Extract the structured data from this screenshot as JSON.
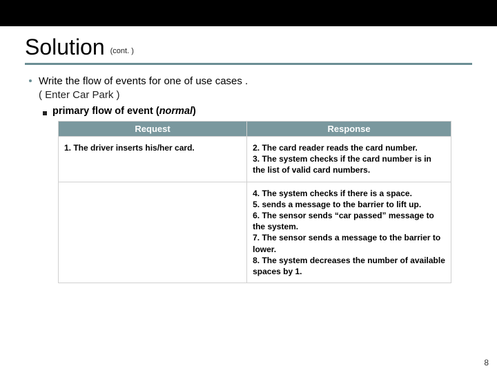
{
  "title": "Solution",
  "title_suffix": "(cont. )",
  "bullet": {
    "line1": "Write the flow of events for one of use cases .",
    "line2": "( Enter Car Park )"
  },
  "sub_bullet": {
    "prefix": "primary flow of event (",
    "italic": "normal",
    "suffix": ")"
  },
  "table": {
    "headers": {
      "left": "Request",
      "right": "Response"
    },
    "rows": [
      {
        "left": "1. The driver inserts his/her card.",
        "right": "2. The card reader reads the card number.\n3. The system checks if the card number is in the list of valid card numbers."
      },
      {
        "left": "",
        "right": "4. The system checks if there is a space.\n5. sends a message to the barrier to lift up.\n6. The sensor sends “car passed” message to the system.\n7. The sensor sends a message to the barrier to lower.\n8. The system decreases the number of available spaces by 1."
      }
    ]
  },
  "page_number": "8"
}
